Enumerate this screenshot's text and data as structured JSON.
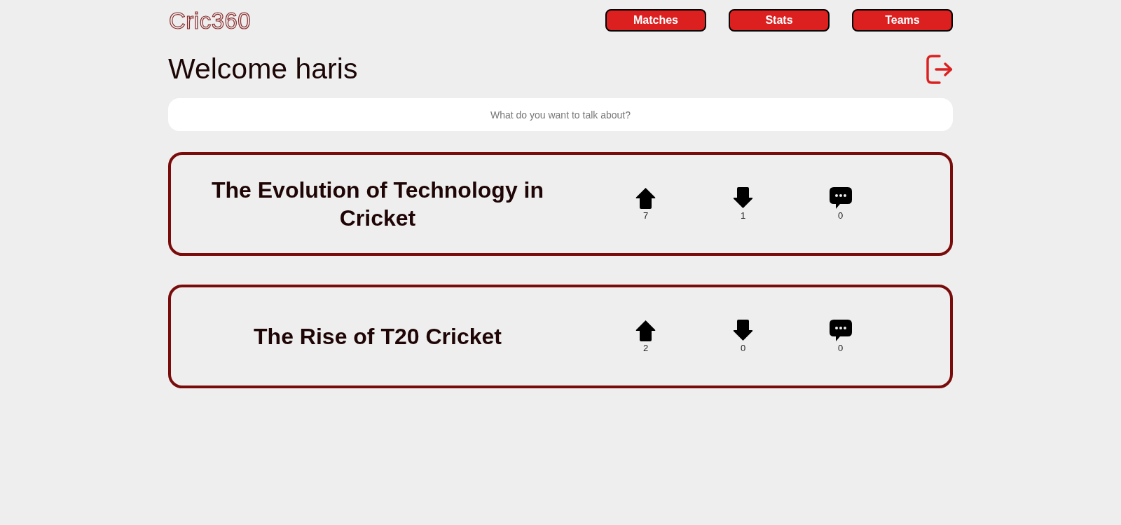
{
  "header": {
    "logo": "Cric360",
    "nav": [
      "Matches",
      "Stats",
      "Teams"
    ]
  },
  "welcome": {
    "greeting": "Welcome haris"
  },
  "search": {
    "placeholder": "What do you want to talk about?"
  },
  "posts": [
    {
      "title": "The Evolution of Technology in Cricket",
      "stats": [
        {
          "kind": "upvote",
          "count": "7"
        },
        {
          "kind": "downvote",
          "count": "1"
        },
        {
          "kind": "comment",
          "count": "0"
        }
      ]
    },
    {
      "title": "The Rise of T20 Cricket",
      "stats": [
        {
          "kind": "upvote",
          "count": "2"
        },
        {
          "kind": "downvote",
          "count": "0"
        },
        {
          "kind": "comment",
          "count": "0"
        }
      ]
    }
  ]
}
